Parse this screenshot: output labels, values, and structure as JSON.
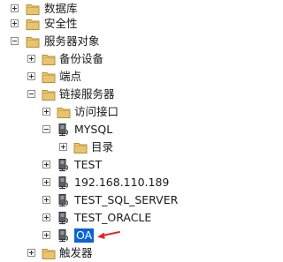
{
  "tree": {
    "accent_color": "#0a64d6",
    "arrow_color": "#e4262c",
    "items": [
      {
        "label": "数据库",
        "icon": "folder-icon",
        "expander": "plus"
      },
      {
        "label": "安全性",
        "icon": "folder-icon",
        "expander": "plus"
      },
      {
        "label": "服务器对象",
        "icon": "folder-icon",
        "expander": "minus"
      },
      {
        "label": "备份设备",
        "icon": "folder-icon",
        "expander": "plus"
      },
      {
        "label": "端点",
        "icon": "folder-icon",
        "expander": "plus"
      },
      {
        "label": "链接服务器",
        "icon": "folder-icon",
        "expander": "minus"
      },
      {
        "label": "访问接口",
        "icon": "folder-icon",
        "expander": "plus"
      },
      {
        "label": "MYSQL",
        "icon": "linked-server-icon",
        "expander": "minus"
      },
      {
        "label": "目录",
        "icon": "folder-icon",
        "expander": "plus"
      },
      {
        "label": "TEST",
        "icon": "linked-server-icon",
        "expander": "plus"
      },
      {
        "label": "192.168.110.189",
        "icon": "linked-server-icon",
        "expander": "plus"
      },
      {
        "label": "TEST_SQL_SERVER",
        "icon": "linked-server-icon",
        "expander": "plus"
      },
      {
        "label": "TEST_ORACLE",
        "icon": "linked-server-icon",
        "expander": "plus"
      },
      {
        "label": "OA",
        "icon": "linked-server-icon",
        "expander": "plus",
        "selected": true
      },
      {
        "label": "触发器",
        "icon": "folder-icon",
        "expander": "plus"
      }
    ]
  }
}
